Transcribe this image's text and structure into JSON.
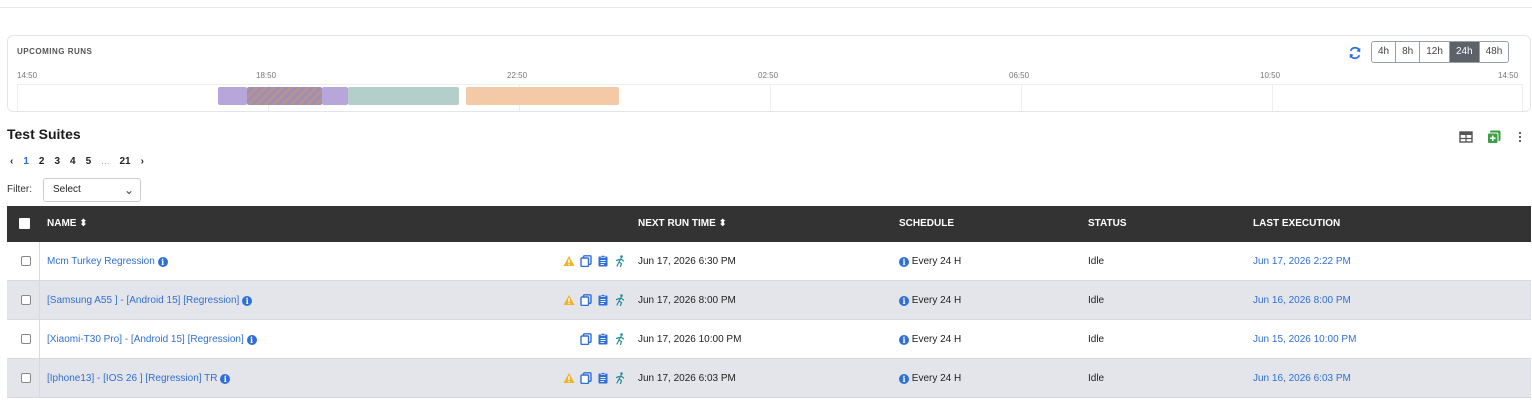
{
  "upcoming": {
    "title": "UPCOMING RUNS",
    "ticks": [
      "14:50",
      "18:50",
      "22:50",
      "02:50",
      "06:50",
      "10:50",
      "14:50"
    ],
    "ranges": [
      "4h",
      "8h",
      "12h",
      "24h",
      "48h"
    ],
    "active_range": "24h",
    "bars": [
      {
        "color": "#b7a6d9",
        "pattern": false
      },
      {
        "color": "#b9928f",
        "pattern": true
      },
      {
        "color": "#b7a6d9",
        "pattern": false
      },
      {
        "color": "#b4cfc9",
        "pattern": false
      },
      {
        "color": "#f3c9a7",
        "pattern": false
      }
    ]
  },
  "section": {
    "title": "Test Suites"
  },
  "pager": {
    "prev": "‹",
    "pages": [
      "1",
      "2",
      "3",
      "4",
      "5"
    ],
    "dots": "...",
    "last": "21",
    "next": "›",
    "current": "1"
  },
  "filter": {
    "label": "Filter:",
    "value": "Select",
    "chevron": "⌄"
  },
  "table": {
    "headers": {
      "name": "NAME ⬍",
      "next_run": "NEXT RUN TIME ⬍",
      "schedule": "SCHEDULE",
      "status": "STATUS",
      "last_execution": "LAST EXECUTION"
    },
    "rows": [
      {
        "name": "Mcm Turkey Regression",
        "warning": true,
        "next_run": "Jun 17, 2026 6:30 PM",
        "schedule": "Every 24 H",
        "status": "Idle",
        "last_execution": "Jun 17, 2026 2:22 PM"
      },
      {
        "name": "[Samsung A55 ] - [Android 15] [Regression]",
        "warning": true,
        "next_run": "Jun 17, 2026 8:00 PM",
        "schedule": "Every 24 H",
        "status": "Idle",
        "last_execution": "Jun 16, 2026 8:00 PM"
      },
      {
        "name": "[Xiaomi-T30 Pro] - [Android 15] [Regression]",
        "warning": false,
        "next_run": "Jun 17, 2026 10:00 PM",
        "schedule": "Every 24 H",
        "status": "Idle",
        "last_execution": "Jun 15, 2026 10:00 PM"
      },
      {
        "name": "[Iphone13] - [IOS 26 ] [Regression] TR",
        "warning": true,
        "next_run": "Jun 17, 2026 6:03 PM",
        "schedule": "Every 24 H",
        "status": "Idle",
        "last_execution": "Jun 16, 2026 6:03 PM"
      }
    ]
  },
  "colors": {
    "accent": "#2f6fd6",
    "header_bg": "#333333",
    "warning": "#f0b429",
    "add_green": "#3aa046"
  },
  "icons": {
    "refresh": "refresh-icon",
    "table_view": "table-view-icon",
    "add": "add-icon",
    "more": "more-vertical-icon",
    "row_actions": [
      "warning-icon",
      "copy-icon",
      "clipboard-icon",
      "run-icon"
    ],
    "info": "info-icon"
  }
}
